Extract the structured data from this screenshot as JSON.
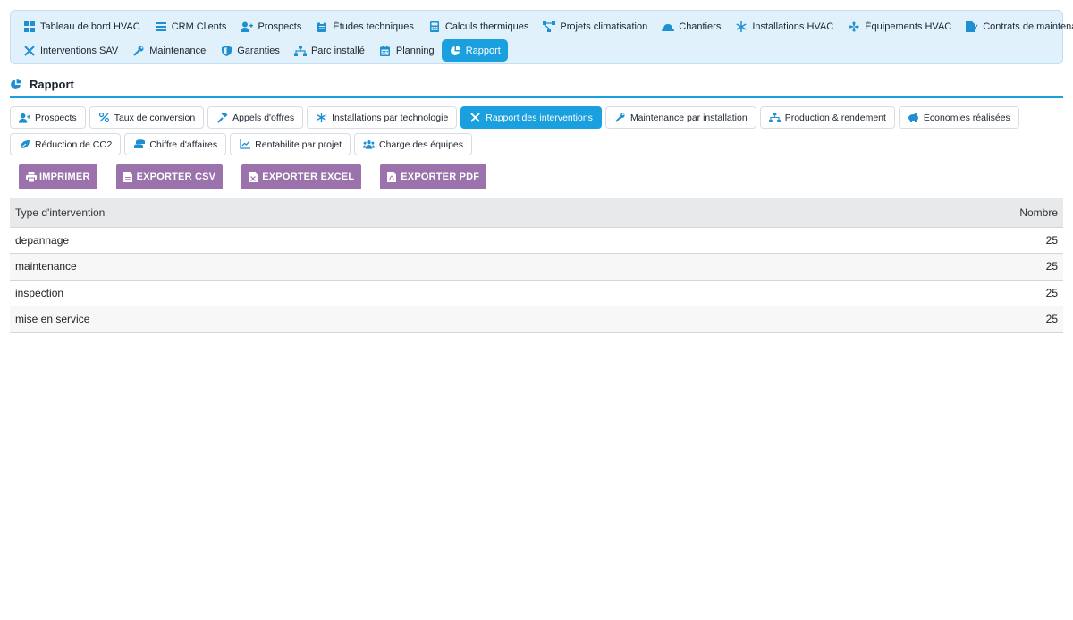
{
  "topnav": {
    "row1": [
      {
        "label": "Tableau de bord HVAC",
        "icon": "dashboard-icon"
      },
      {
        "label": "CRM Clients",
        "icon": "list-icon"
      },
      {
        "label": "Prospects",
        "icon": "user-plus-icon"
      },
      {
        "label": "Études techniques",
        "icon": "clipboard-icon"
      },
      {
        "label": "Calculs thermiques",
        "icon": "calculator-icon"
      },
      {
        "label": "Projets climatisation",
        "icon": "project-diagram-icon"
      },
      {
        "label": "Chantiers",
        "icon": "hard-hat-icon"
      },
      {
        "label": "Installations HVAC",
        "icon": "snowflake-icon"
      },
      {
        "label": "Équipements HVAC",
        "icon": "fan-icon"
      },
      {
        "label": "Contrats de maintenance",
        "icon": "file-signature-icon"
      }
    ],
    "row2": [
      {
        "label": "Interventions SAV",
        "icon": "tools-icon"
      },
      {
        "label": "Maintenance",
        "icon": "wrench-icon"
      },
      {
        "label": "Garanties",
        "icon": "shield-icon"
      },
      {
        "label": "Parc installé",
        "icon": "sitemap-icon"
      },
      {
        "label": "Planning",
        "icon": "calendar-icon"
      },
      {
        "label": "Rapport",
        "icon": "chart-pie-icon",
        "active": true
      }
    ]
  },
  "section": {
    "title": "Rapport",
    "icon": "chart-pie-icon"
  },
  "tabs": {
    "row1": [
      {
        "label": "Prospects",
        "icon": "user-plus-icon"
      },
      {
        "label": "Taux de conversion",
        "icon": "percent-icon"
      },
      {
        "label": "Appels d'offres",
        "icon": "gavel-icon"
      },
      {
        "label": "Installations par technologie",
        "icon": "snowflake-icon"
      },
      {
        "label": "Rapport des interventions",
        "icon": "tools-icon",
        "active": true
      },
      {
        "label": "Maintenance par installation",
        "icon": "wrench-icon"
      },
      {
        "label": "Production & rendement",
        "icon": "sitemap-icon"
      },
      {
        "label": "Économies réalisées",
        "icon": "piggy-bank-icon"
      }
    ],
    "row2": [
      {
        "label": "Réduction de CO2",
        "icon": "leaf-icon"
      },
      {
        "label": "Chiffre d'affaires",
        "icon": "coins-icon"
      },
      {
        "label": "Rentabilite par projet",
        "icon": "chart-line-icon"
      },
      {
        "label": "Charge des équipes",
        "icon": "users-icon"
      }
    ]
  },
  "actions": [
    {
      "label": "Imprimer",
      "icon": "print-icon"
    },
    {
      "label": "Exporter CSV",
      "icon": "file-csv-icon"
    },
    {
      "label": "Exporter Excel",
      "icon": "file-excel-icon"
    },
    {
      "label": "Exporter PDF",
      "icon": "file-pdf-icon"
    }
  ],
  "table": {
    "headers": [
      "Type d'intervention",
      "Nombre"
    ],
    "rows": [
      [
        "depannage",
        "25"
      ],
      [
        "maintenance",
        "25"
      ],
      [
        "inspection",
        "25"
      ],
      [
        "mise en service",
        "25"
      ]
    ]
  },
  "colors": {
    "accent": "#1aa0de",
    "nav_bg": "#e0f1fb",
    "button": "#9b72ac"
  }
}
